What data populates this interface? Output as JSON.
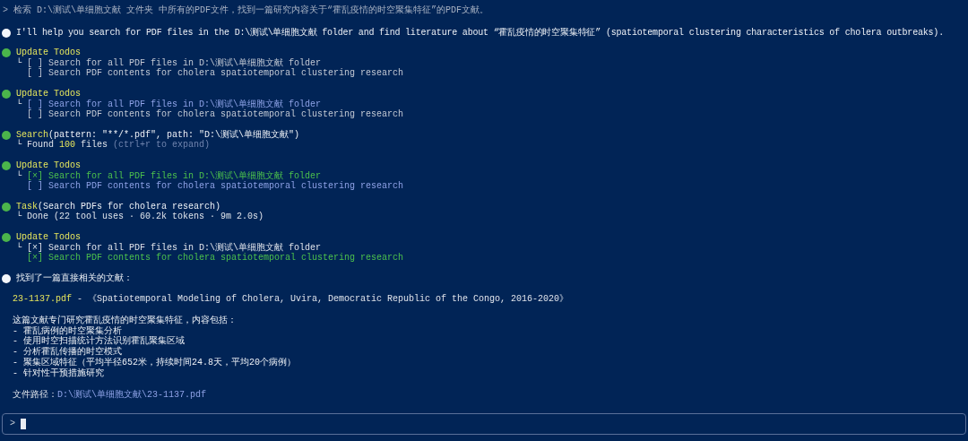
{
  "prompt": {
    "symbol": ">",
    "text": "检索 D:\\测试\\单细胞文献 文件夹 中所有的PDF文件，找到一篇研究内容关于“霍乱疫情的时空聚集特征”的PDF文献。"
  },
  "entries": [
    {
      "kind": "message",
      "text": "I'll help you search for PDF files in the D:\\测试\\单细胞文献 folder and find literature about “霍乱疫情的时空聚集特征” (spatiotemporal clustering characteristics of cholera outbreaks)."
    },
    {
      "kind": "todos",
      "title": "Update Todos",
      "branch": "└",
      "items": [
        {
          "box": "[ ]",
          "text": "Search for all PDF files in D:\\测试\\单细胞文献 folder",
          "checked": false,
          "active": false
        },
        {
          "box": "[ ]",
          "text": "Search PDF contents for cholera spatiotemporal clustering research",
          "checked": false,
          "active": false
        }
      ]
    },
    {
      "kind": "todos",
      "title": "Update Todos",
      "branch": "└",
      "items": [
        {
          "box": "[ ]",
          "text": "Search for all PDF files in D:\\测试\\单细胞文献 folder",
          "checked": false,
          "active": true
        },
        {
          "box": "[ ]",
          "text": "Search PDF contents for cholera spatiotemporal clustering research",
          "checked": false,
          "active": false
        }
      ]
    },
    {
      "kind": "tool",
      "name": "Search",
      "args": "(pattern: \"**/*.pdf\", path: \"D:\\测试\\单细胞文献\")",
      "branch": "└",
      "result": {
        "lead": "Found ",
        "count": "100",
        "rest": " files ",
        "hint": "(ctrl+r to expand)"
      }
    },
    {
      "kind": "todos",
      "title": "Update Todos",
      "branch": "└",
      "items": [
        {
          "box": "[×]",
          "text": "Search for all PDF files in D:\\测试\\单细胞文献 folder",
          "checked": true,
          "active": true
        },
        {
          "box": "[ ]",
          "text": "Search PDF contents for cholera spatiotemporal clustering research",
          "checked": false,
          "active": true
        }
      ]
    },
    {
      "kind": "tool",
      "name": "Task",
      "args": "(Search PDFs for cholera research)",
      "branch": "└",
      "result": {
        "lead": "Done (22 tool uses · 60.2k tokens · 9m 2.0s)"
      }
    },
    {
      "kind": "todos",
      "title": "Update Todos",
      "branch": "└",
      "items": [
        {
          "box": "[×]",
          "text": "Search for all PDF files in D:\\测试\\单细胞文献 folder",
          "checked": true,
          "active": false
        },
        {
          "box": "[×]",
          "text": "Search PDF contents for cholera spatiotemporal clustering research",
          "checked": true,
          "active": true
        }
      ]
    },
    {
      "kind": "answer",
      "heading": "找到了一篇直接相关的文献：",
      "file_name": "23-1137.pdf",
      "file_title": " - 《Spatiotemporal Modeling of Cholera, Uvira, Democratic Republic of the Congo, 2016-2020》",
      "paragraph": [
        "这篇文献专门研究霍乱疫情的时空聚集特征，内容包括：",
        "- 霍乱病例的时空聚集分析",
        "- 使用时空扫描统计方法识别霍乱聚集区域",
        "- 分析霍乱传播的时空模式",
        "- 聚集区域特征（平均半径652米，持续时间24.8天，平均20个病例）",
        "- 针对性干预措施研究"
      ],
      "path_label": "文件路径：",
      "path": "D:\\测试\\单细胞文献\\23-1137.pdf"
    }
  ],
  "input": {
    "symbol": ">"
  }
}
